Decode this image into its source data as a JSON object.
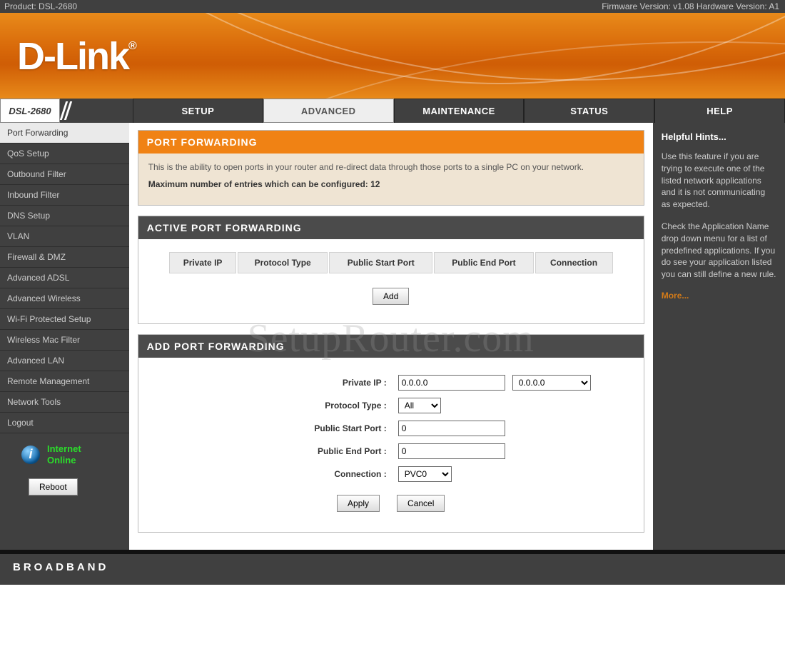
{
  "topbar": {
    "product_label": "Product: DSL-2680",
    "firmware_label": "Firmware Version: v1.08 Hardware Version: A1"
  },
  "logo_text": "D-Link",
  "device_model": "DSL-2680",
  "nav": {
    "tabs": [
      {
        "label": "SETUP",
        "active": false
      },
      {
        "label": "ADVANCED",
        "active": true
      },
      {
        "label": "MAINTENANCE",
        "active": false
      },
      {
        "label": "STATUS",
        "active": false
      },
      {
        "label": "HELP",
        "active": false
      }
    ]
  },
  "sidebar": {
    "items": [
      {
        "label": "Port Forwarding",
        "active": true
      },
      {
        "label": "QoS Setup",
        "active": false
      },
      {
        "label": "Outbound Filter",
        "active": false
      },
      {
        "label": "Inbound Filter",
        "active": false
      },
      {
        "label": "DNS Setup",
        "active": false
      },
      {
        "label": "VLAN",
        "active": false
      },
      {
        "label": "Firewall & DMZ",
        "active": false
      },
      {
        "label": "Advanced ADSL",
        "active": false
      },
      {
        "label": "Advanced Wireless",
        "active": false
      },
      {
        "label": "Wi-Fi Protected Setup",
        "active": false
      },
      {
        "label": "Wireless Mac Filter",
        "active": false
      },
      {
        "label": "Advanced LAN",
        "active": false
      },
      {
        "label": "Remote Management",
        "active": false
      },
      {
        "label": "Network Tools",
        "active": false
      },
      {
        "label": "Logout",
        "active": false
      }
    ],
    "status_line1": "Internet",
    "status_line2": "Online",
    "reboot_label": "Reboot"
  },
  "panels": {
    "intro": {
      "title": "PORT FORWARDING",
      "desc": "This is the ability to open ports in your router and re-direct data through those ports to a single PC on your network.",
      "max": "Maximum number of entries which can be configured: 12"
    },
    "active": {
      "title": "ACTIVE PORT FORWARDING",
      "cols": [
        "Private IP",
        "Protocol Type",
        "Public Start Port",
        "Public End Port",
        "Connection"
      ],
      "add_label": "Add"
    },
    "addform": {
      "title": "ADD PORT FORWARDING",
      "labels": {
        "private_ip": "Private IP :",
        "protocol": "Protocol Type :",
        "start_port": "Public Start Port :",
        "end_port": "Public End Port :",
        "connection": "Connection :"
      },
      "values": {
        "private_ip": "0.0.0.0",
        "ip_dropdown": "0.0.0.0",
        "protocol": "All",
        "start_port": "0",
        "end_port": "0",
        "connection": "PVC0"
      },
      "apply_label": "Apply",
      "cancel_label": "Cancel"
    }
  },
  "help": {
    "title": "Helpful Hints...",
    "p1": "Use this feature if you are trying to execute one of the listed network applications and it is not communicating as expected.",
    "p2": "Check the Application Name drop down menu for a list of predefined applications. If you do see your application listed you can still define a new rule.",
    "more": "More..."
  },
  "footer_text": "BROADBAND",
  "watermark": "SetupRouter.com"
}
